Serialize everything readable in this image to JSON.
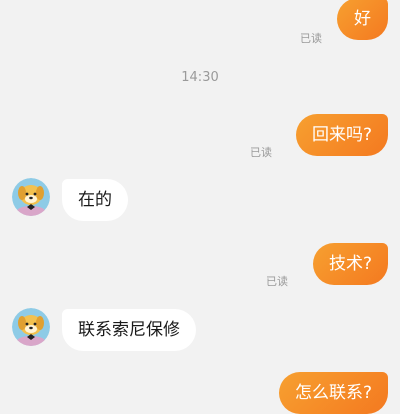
{
  "messages": [
    {
      "side": "out",
      "text": "好",
      "status": "已读"
    },
    {
      "side": "out",
      "text": "回来吗?",
      "status": "已读"
    },
    {
      "side": "in",
      "text": "在的"
    },
    {
      "side": "out",
      "text": "技术?",
      "status": "已读"
    },
    {
      "side": "in",
      "text": "联系索尼保修"
    },
    {
      "side": "out",
      "text": "怎么联系?"
    }
  ],
  "timestamp": "14:30",
  "colors": {
    "outgoing": "#f47920",
    "incoming": "#ffffff",
    "background": "#f2f2f2"
  }
}
